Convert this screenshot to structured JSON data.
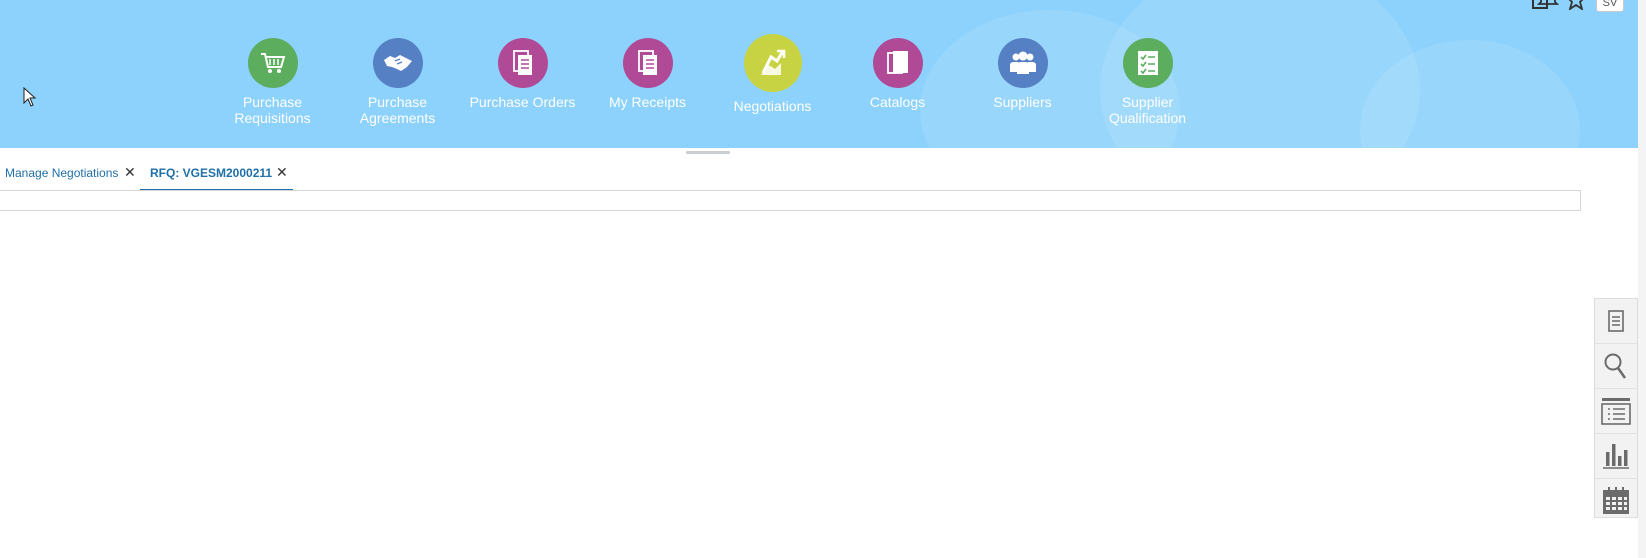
{
  "apps": [
    {
      "id": "purchase-requisitions",
      "label": "Purchase\nRequisitions",
      "color": "#5cad5e",
      "icon": "cart-icon"
    },
    {
      "id": "purchase-agreements",
      "label": "Purchase\nAgreements",
      "color": "#5580c3",
      "icon": "handshake-icon"
    },
    {
      "id": "purchase-orders",
      "label": "Purchase Orders",
      "color": "#b04a97",
      "icon": "documents-icon"
    },
    {
      "id": "my-receipts",
      "label": "My Receipts",
      "color": "#b04a97",
      "icon": "documents-icon"
    },
    {
      "id": "negotiations",
      "label": "Negotiations",
      "color": "#c8d344",
      "icon": "negotiation-icon"
    },
    {
      "id": "catalogs",
      "label": "Catalogs",
      "color": "#b04a97",
      "icon": "catalog-icon"
    },
    {
      "id": "suppliers",
      "label": "Suppliers",
      "color": "#5580c3",
      "icon": "people-icon"
    },
    {
      "id": "supplier-qualification",
      "label": "Supplier\nQualification",
      "color": "#5cad5e",
      "icon": "checklist-icon"
    }
  ],
  "header": {
    "user_initials": "SV",
    "icons": [
      "home-icon",
      "star-icon",
      "flag-icon",
      "bell-icon"
    ]
  },
  "tabs": [
    {
      "label": "Manage Negotiations",
      "active": false
    },
    {
      "label": "RFQ: VGESM2000211",
      "active": true
    }
  ],
  "side_tools": [
    "document-icon",
    "search-icon",
    "list-icon",
    "chart-icon",
    "calendar-icon"
  ],
  "colors": {
    "banner": "#8dd2fc",
    "link": "#1f6fa8"
  }
}
